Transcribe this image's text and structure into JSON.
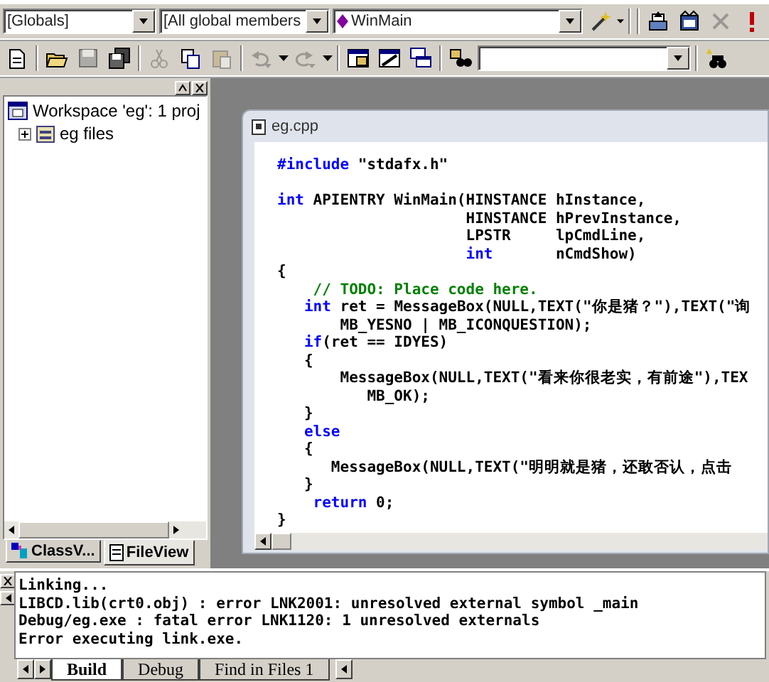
{
  "toolbar_top": {
    "combos": [
      {
        "value": "[Globals]",
        "kind": "plain"
      },
      {
        "value": "[All global members",
        "kind": "plain"
      },
      {
        "value": "WinMain",
        "kind": "member"
      }
    ],
    "buttons": [
      {
        "kind": "wizard",
        "disabled": false
      },
      {
        "kind": "compile",
        "disabled": false
      },
      {
        "kind": "build",
        "disabled": false
      },
      {
        "kind": "stop",
        "disabled": true
      },
      {
        "kind": "execute",
        "disabled": false
      }
    ]
  },
  "toolbar_standard": {
    "buttons": [
      {
        "kind": "new",
        "disabled": false
      },
      {
        "kind": "open",
        "disabled": false
      },
      {
        "kind": "save",
        "disabled": true
      },
      {
        "kind": "save-all",
        "disabled": false
      },
      {
        "kind": "cut",
        "disabled": true
      },
      {
        "kind": "copy",
        "disabled": false
      },
      {
        "kind": "paste",
        "disabled": true
      },
      {
        "kind": "undo",
        "disabled": true
      },
      {
        "kind": "redo",
        "disabled": true
      },
      {
        "kind": "workspace",
        "disabled": false
      },
      {
        "kind": "output",
        "disabled": false
      },
      {
        "kind": "windows",
        "disabled": false
      },
      {
        "kind": "find-in-files",
        "disabled": false
      }
    ],
    "find_buttons": [
      {
        "kind": "find",
        "disabled": false
      }
    ]
  },
  "workspace": {
    "tree": [
      {
        "label": "Workspace 'eg': 1 proj",
        "kind": "workspace",
        "children": [
          {
            "label": "eg files",
            "kind": "project",
            "expanded": false
          }
        ]
      }
    ],
    "tabs": [
      {
        "label": "ClassV...",
        "kind": "class",
        "selected": false
      },
      {
        "label": "FileView",
        "kind": "file",
        "selected": true
      }
    ]
  },
  "editor": {
    "title": "eg.cpp",
    "lines": [
      {
        "kind": "code",
        "tokens": [
          {
            "text": "#include",
            "kind": "keyword"
          },
          {
            "text": " \"stdafx.h\"",
            "kind": "plain"
          }
        ]
      },
      {
        "kind": "blank"
      },
      {
        "kind": "code",
        "tokens": [
          {
            "text": "int",
            "kind": "keyword"
          },
          {
            "text": " APIENTRY WinMain(HINSTANCE hInstance,",
            "kind": "plain"
          }
        ]
      },
      {
        "kind": "code",
        "tokens": [
          {
            "text": "                     HINSTANCE hPrevInstance,",
            "kind": "plain"
          }
        ]
      },
      {
        "kind": "code",
        "tokens": [
          {
            "text": "                     LPSTR     lpCmdLine,",
            "kind": "plain"
          }
        ]
      },
      {
        "kind": "code",
        "tokens": [
          {
            "text": "                     int",
            "kind": "keyword"
          },
          {
            "text": "       nCmdShow)",
            "kind": "plain"
          }
        ]
      },
      {
        "kind": "code",
        "tokens": [
          {
            "text": "{",
            "kind": "plain"
          }
        ]
      },
      {
        "kind": "code",
        "tokens": [
          {
            "text": "    // TODO: Place code here.",
            "kind": "comment"
          }
        ]
      },
      {
        "kind": "code",
        "tokens": [
          {
            "text": "   int",
            "kind": "keyword"
          },
          {
            "text": " ret = MessageBox(NULL,TEXT(\"你是猪？\"),TEXT(\"询",
            "kind": "plain"
          }
        ]
      },
      {
        "kind": "code",
        "tokens": [
          {
            "text": "       MB_YESNO | MB_ICONQUESTION);",
            "kind": "plain"
          }
        ]
      },
      {
        "kind": "code",
        "tokens": [
          {
            "text": "   if",
            "kind": "keyword"
          },
          {
            "text": "(ret == IDYES)",
            "kind": "plain"
          }
        ]
      },
      {
        "kind": "code",
        "tokens": [
          {
            "text": "   {",
            "kind": "plain"
          }
        ]
      },
      {
        "kind": "code",
        "tokens": [
          {
            "text": "       MessageBox(NULL,TEXT(\"看来你很老实，有前途\"),TEX",
            "kind": "plain"
          }
        ]
      },
      {
        "kind": "code",
        "tokens": [
          {
            "text": "          MB_OK);",
            "kind": "plain"
          }
        ]
      },
      {
        "kind": "code",
        "tokens": [
          {
            "text": "   }",
            "kind": "plain"
          }
        ]
      },
      {
        "kind": "code",
        "tokens": [
          {
            "text": "   else",
            "kind": "keyword"
          }
        ]
      },
      {
        "kind": "code",
        "tokens": [
          {
            "text": "   {",
            "kind": "plain"
          }
        ]
      },
      {
        "kind": "code",
        "tokens": [
          {
            "text": "      MessageBox(NULL,TEXT(\"明明就是猪，还敢否认，点击",
            "kind": "plain"
          }
        ]
      },
      {
        "kind": "code",
        "tokens": [
          {
            "text": "   }",
            "kind": "plain"
          }
        ]
      },
      {
        "kind": "code",
        "tokens": [
          {
            "text": "    return",
            "kind": "keyword"
          },
          {
            "text": " 0;",
            "kind": "plain"
          }
        ]
      },
      {
        "kind": "code",
        "tokens": [
          {
            "text": "}",
            "kind": "plain"
          }
        ]
      }
    ]
  },
  "output": {
    "lines": [
      "Linking...",
      "LIBCD.lib(crt0.obj) : error LNK2001: unresolved external symbol _main",
      "Debug/eg.exe : fatal error LNK1120: 1 unresolved externals",
      "Error executing link.exe."
    ],
    "tabs": [
      {
        "label": "Build",
        "selected": true
      },
      {
        "label": "Debug",
        "selected": false
      },
      {
        "label": "Find in Files 1",
        "selected": false
      }
    ]
  }
}
